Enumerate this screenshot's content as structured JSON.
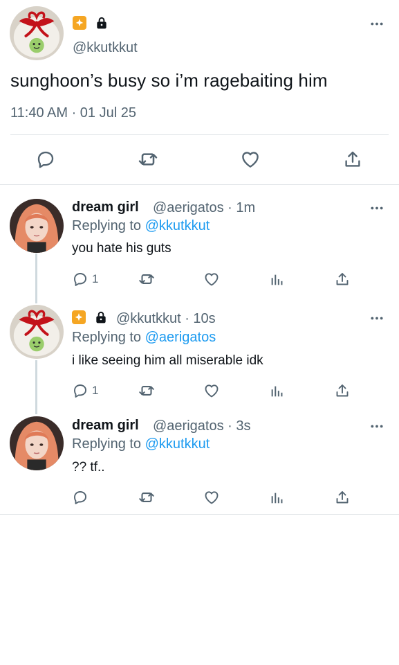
{
  "main_tweet": {
    "handle": "@kkutkkut",
    "text": "sunghoon’s busy so i’m ragebaiting him",
    "timestamp": "11:40 AM · 01 Jul 25",
    "badges": [
      "sparkle-badge-icon",
      "lock-icon"
    ]
  },
  "replies": [
    {
      "name": "dream girl",
      "meta": "@aerigatos · 1m",
      "replying_label": "Replying to",
      "replying_to": "@kkutkkut",
      "text": "you hate his guts",
      "reply_count": "1"
    },
    {
      "name": "",
      "meta": "@kkutkkut · 10s",
      "replying_label": "Replying to",
      "replying_to": "@aerigatos",
      "text": "i like seeing him all miserable idk",
      "reply_count": "1"
    },
    {
      "name": "dream girl",
      "meta": "@aerigatos · 3s",
      "replying_label": "Replying to",
      "replying_to": "@kkutkkut",
      "text": "?? tf..",
      "reply_count": ""
    }
  ],
  "colors": {
    "accent": "#1d9bf0",
    "muted": "#536471",
    "badge": "#f5a623",
    "divider": "#e1e5e8"
  }
}
